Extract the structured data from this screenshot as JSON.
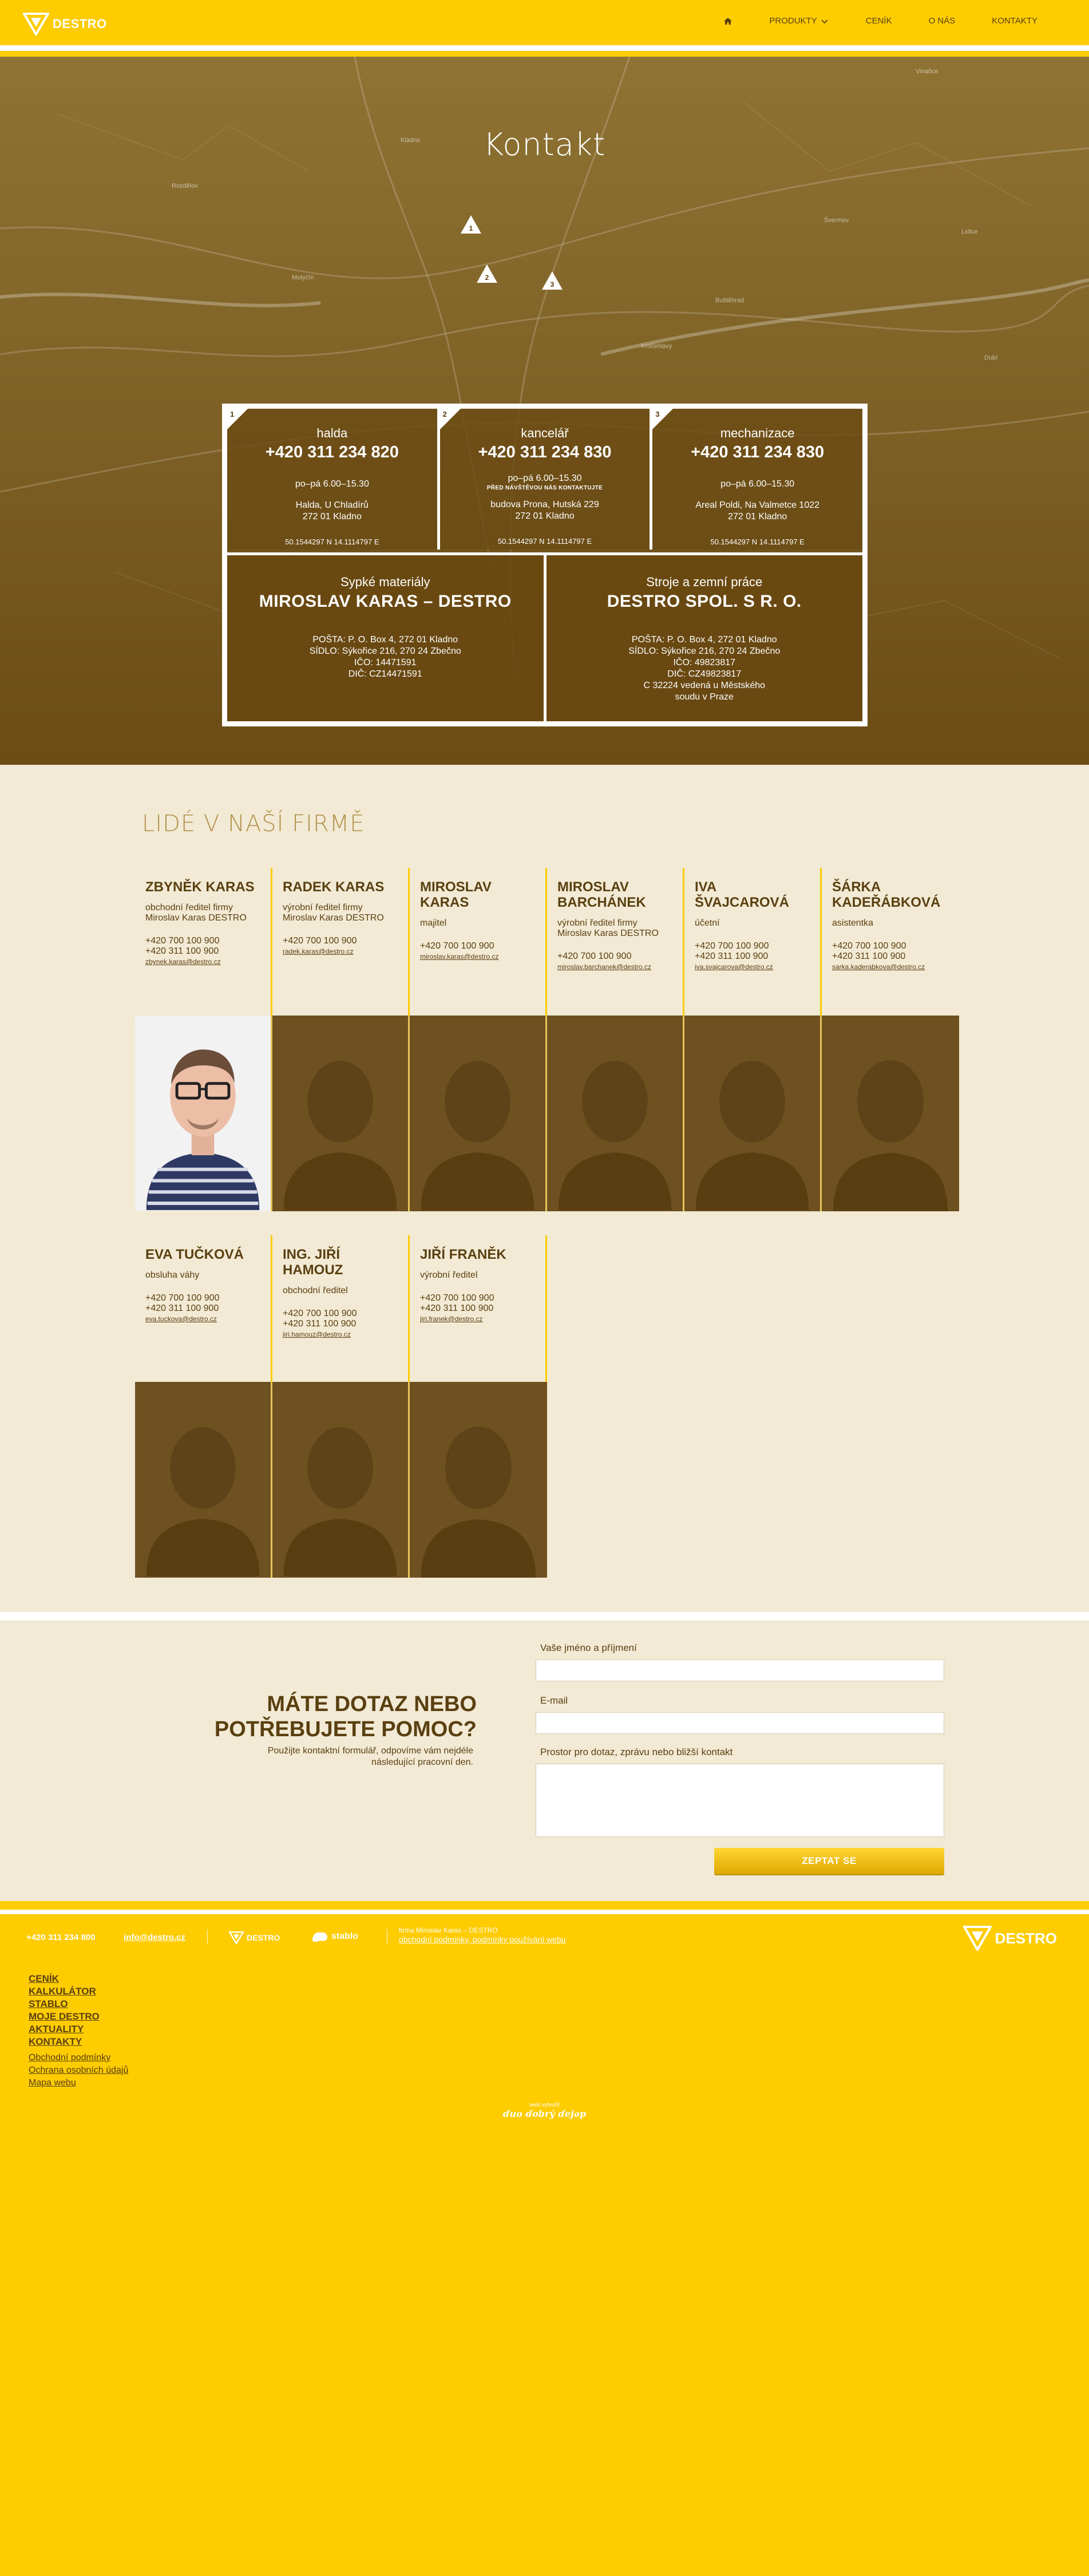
{
  "header": {
    "logo_text": "DESTRO",
    "nav": {
      "home_icon": "home-icon",
      "products": "PRODUKTY",
      "pricelist": "CENÍK",
      "about": "O NÁS",
      "contacts": "KONTAKTY"
    }
  },
  "hero": {
    "title": "Kontakt",
    "map_labels": [
      "Kladno",
      "Dubí",
      "Vinařice",
      "Švermov",
      "Motyčín",
      "Rozdělov",
      "Kročehlavy",
      "Lidice",
      "Buštěhrad"
    ],
    "markers": [
      "1",
      "2",
      "3"
    ],
    "locations": [
      {
        "num": "1",
        "name": "halda",
        "phone": "+420 311 234 820",
        "hours": "po–pá 6.00–15.30",
        "note": "",
        "addr1": "Halda, U Chladírů",
        "addr2": "272 01  Kladno",
        "gps": "50.1544297 N   14.1114797 E"
      },
      {
        "num": "2",
        "name": "kancelář",
        "phone": "+420 311 234 830",
        "hours": "po–pá 6.00–15.30",
        "note": "PŘED NÁVŠTĚVOU NÁS KONTAKTUJTE",
        "addr1": "budova Prona, Hutská 229",
        "addr2": "272 01  Kladno",
        "gps": "50.1544297 N   14.1114797 E"
      },
      {
        "num": "3",
        "name": "mechanizace",
        "phone": "+420 311 234 830",
        "hours": "po–pá 6.00–15.30",
        "note": "",
        "addr1": "Areal Poldi, Na Valmetce 1022",
        "addr2": "272 01  Kladno",
        "gps": "50.1544297 N   14.1114797 E"
      }
    ],
    "firms": [
      {
        "sub": "Sypké materiály",
        "name": "MIROSLAV KARAS – DESTRO",
        "lines": [
          "POŠTA: P. O. Box 4, 272 01  Kladno",
          "SÍDLO: Sýkořice 216, 270 24  Zbečno",
          "IČO: 14471591",
          "DIČ: CZ14471591"
        ]
      },
      {
        "sub": "Stroje a zemní práce",
        "name": "DESTRO SPOL. S R. O.",
        "lines": [
          "POŠTA: P. O. Box 4, 272 01  Kladno",
          "SÍDLO: Sýkořice 216, 270 24  Zbečno",
          "IČO: 49823817",
          "DIČ: CZ49823817",
          "C 32224 vedená u Městského",
          "soudu v Praze"
        ]
      }
    ]
  },
  "people": {
    "title": "LIDÉ V NAŠÍ FIRMĚ",
    "row1": [
      {
        "name": "ZBYNĚK KARAS",
        "role": "obchodní ředitel firmy Miroslav Karas DESTRO",
        "phone1": "+420 700 100 900",
        "phone2": "+420 311 100 900",
        "email": "zbynek.karas@destro.cz"
      },
      {
        "name": "RADEK KARAS",
        "role": "výrobní ředitel firmy Miroslav Karas DESTRO",
        "phone1": "+420 700 100 900",
        "phone2": "",
        "email": "radek.karas@destro.cz"
      },
      {
        "name": "MIROSLAV KARAS",
        "role": "majitel",
        "phone1": "+420 700 100 900",
        "phone2": "",
        "email": "miroslav.karas@destro.cz"
      },
      {
        "name": "MIROSLAV BARCHÁNEK",
        "role": "výrobní ředitel firmy Miroslav Karas DESTRO",
        "phone1": "+420 700 100 900",
        "phone2": "",
        "email": "miroslav.barchanek@destro.cz"
      },
      {
        "name": "IVA ŠVAJCAROVÁ",
        "role": "účetní",
        "phone1": "+420 700 100 900",
        "phone2": "+420 311 100 900",
        "email": "iva.svajcarova@destro.cz"
      },
      {
        "name": "ŠÁRKA KADEŘÁBKOVÁ",
        "role": "asistentka",
        "phone1": "+420 700 100 900",
        "phone2": "+420 311 100 900",
        "email": "sarka.kaderabkova@destro.cz"
      }
    ],
    "row2": [
      {
        "name": "EVA TUČKOVÁ",
        "role": "obsluha váhy",
        "phone1": "+420 700 100 900",
        "phone2": "+420 311 100 900",
        "email": "eva.tuckova@destro.cz"
      },
      {
        "name": "ING. JIŘÍ HAMOUZ",
        "role": "obchodní ředitel",
        "phone1": "+420 700 100 900",
        "phone2": "+420 311 100 900",
        "email": "jiri.hamouz@destro.cz"
      },
      {
        "name": "JIŘÍ FRANĚK",
        "role": "výrobní ředitel",
        "phone1": "+420 700 100 900",
        "phone2": "+420 311 100 900",
        "email": "jiri.franek@destro.cz"
      }
    ]
  },
  "form": {
    "title_line1": "MÁTE DOTAZ NEBO",
    "title_line2": "POTŘEBUJETE POMOC?",
    "desc": "Použijte kontaktní formulář, odpovíme vám nejdéle následující pracovní den.",
    "name_label": "Vaše jméno a příjmení",
    "email_label": "E-mail",
    "message_label": "Prostor pro dotaz, zprávu nebo bližší kontakt",
    "name_value": "",
    "email_value": "",
    "message_value": "",
    "submit": "ZEPTAT SE"
  },
  "footer": {
    "phone": "+420 311 234 800",
    "email": "info@destro.cz",
    "partner1": "DESTRO",
    "partner2": "stablo",
    "firm_line": "firma Miroslav Karas – DESTRO",
    "terms_link": "obchodní podmínky, podmínky používání webu",
    "logo_text": "DESTRO",
    "menu": [
      "CENÍK",
      "KALKULÁTOR",
      "STABLO",
      "MOJE DESTRO",
      "AKTUALITY",
      "KONTAKTY"
    ],
    "links": [
      "Obchodní podmínky",
      "Ochrana osobních údajů",
      "Mapa webu"
    ],
    "credit_small": "web vytvořil",
    "credit_sig": "ɗuo ɗobrý ɗejǝp"
  },
  "colors": {
    "brand_yellow": "#ffcc00",
    "brown": "#5a4010",
    "cream": "#f3ead6",
    "hero_brown": "#7c5f24"
  }
}
